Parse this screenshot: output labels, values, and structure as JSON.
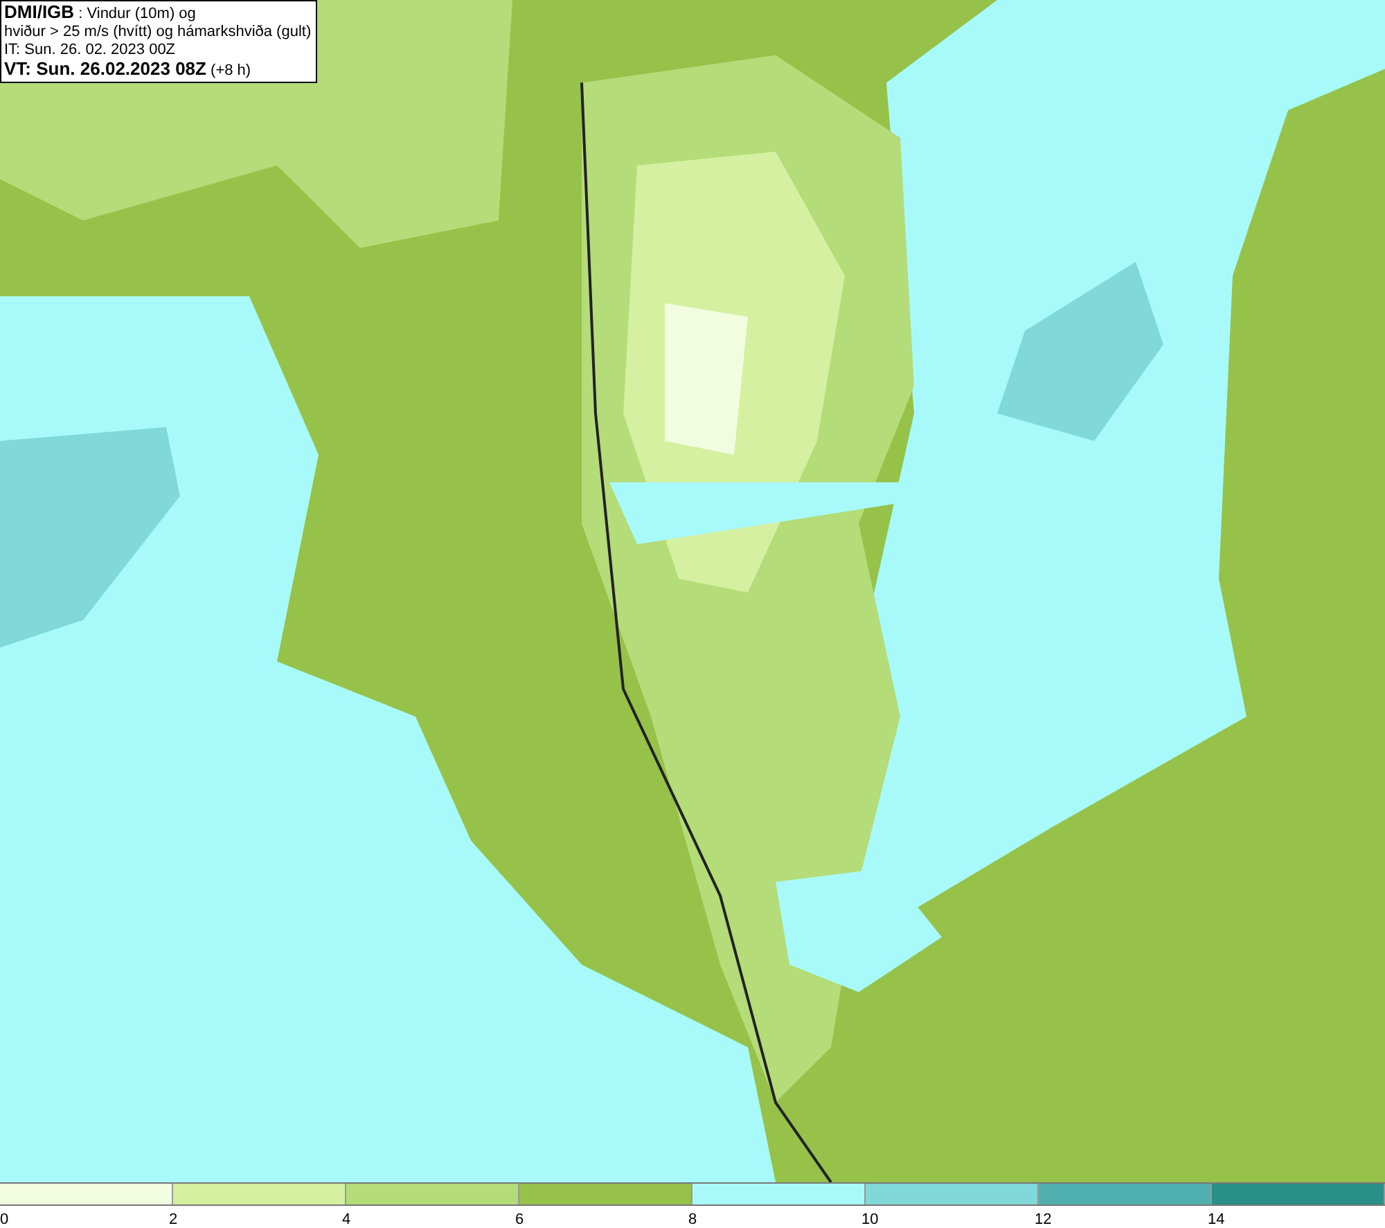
{
  "header": {
    "lines": [
      "**DMI/IGB** : Vindur (10m) og",
      "hviður > 25 m/s (hvítt) og hámarkshviða (gult)",
      "IT: Sun. 26. 02. 2023 00Z",
      "**VT: Sun. 26.02.2023 08Z** (+8 h)"
    ]
  },
  "legend": {
    "bins": [
      {
        "label": "0",
        "color": "#f2fde0"
      },
      {
        "label": "2",
        "color": "#d4f0a0"
      },
      {
        "label": "4",
        "color": "#b4dc78"
      },
      {
        "label": "6",
        "color": "#96c24a"
      },
      {
        "label": "8",
        "color": "#a8fafa"
      },
      {
        "label": "10",
        "color": "#80d8d8"
      },
      {
        "label": "12",
        "color": "#50b0b0"
      },
      {
        "label": "14",
        "color": "#2a9088"
      }
    ]
  }
}
